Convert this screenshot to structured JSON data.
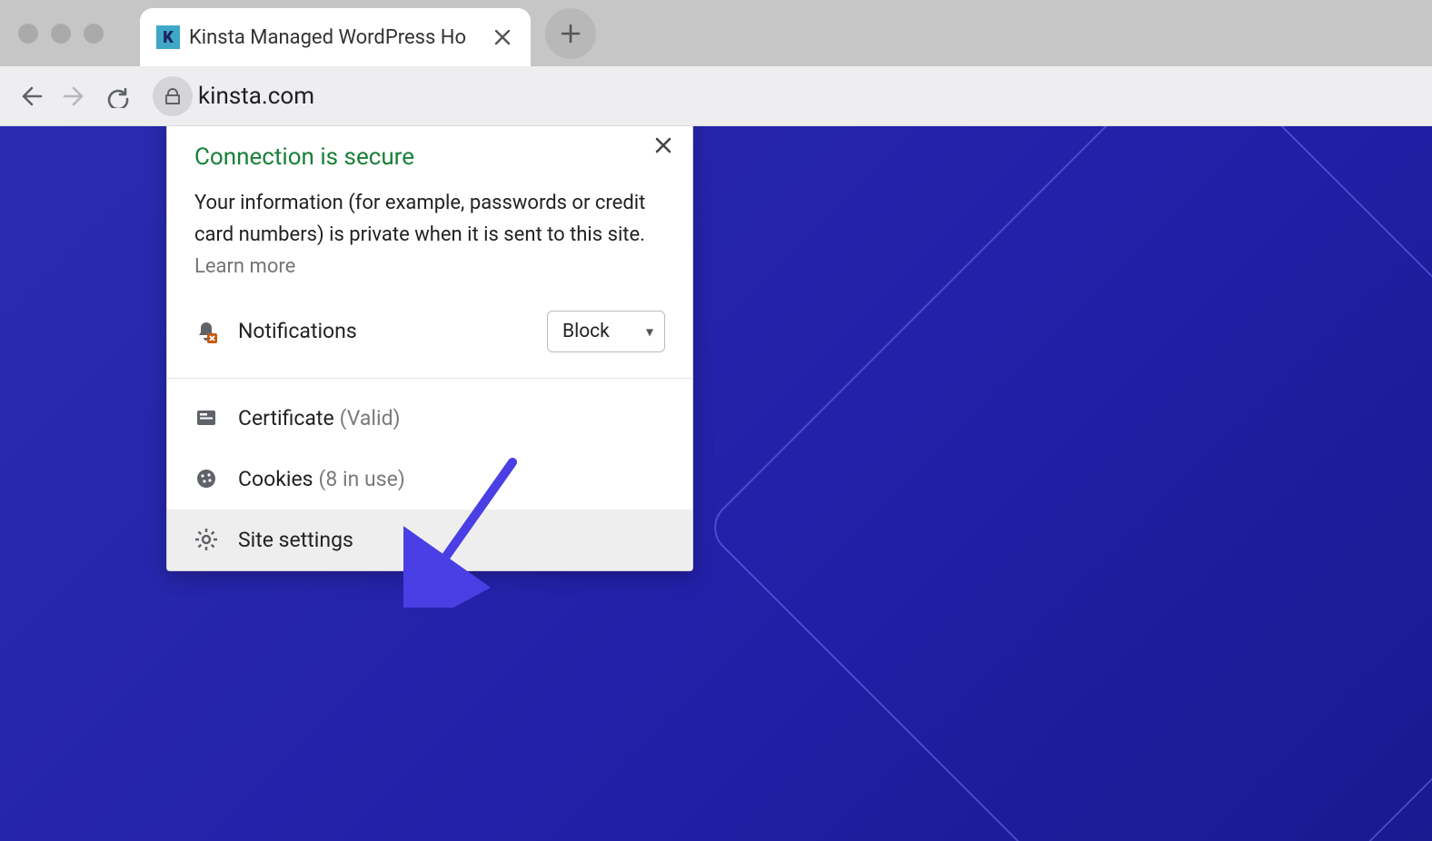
{
  "tab": {
    "title": "Kinsta Managed WordPress Ho",
    "favicon_letter": "K"
  },
  "address_bar": {
    "url": "kinsta.com"
  },
  "popup": {
    "title": "Connection is secure",
    "description": "Your information (for example, passwords or credit card numbers) is private when it is sent to this site. ",
    "learn_more": "Learn more",
    "permission": {
      "label": "Notifications",
      "value": "Block"
    },
    "items": {
      "certificate": {
        "label": "Certificate",
        "sub": "(Valid)"
      },
      "cookies": {
        "label": "Cookies",
        "sub": "(8 in use)"
      },
      "site_settings": {
        "label": "Site settings"
      }
    }
  }
}
